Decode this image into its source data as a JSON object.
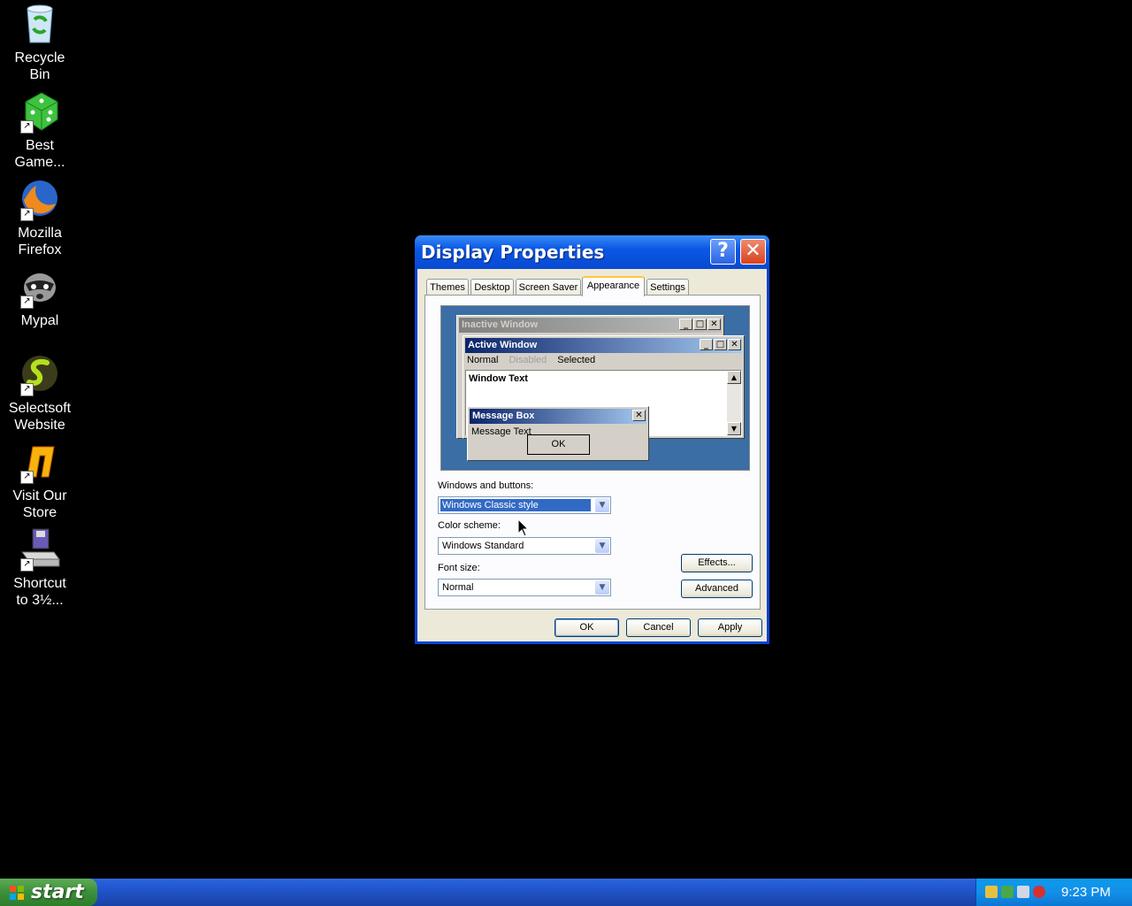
{
  "desktop": {
    "icons": [
      {
        "label": "Recycle\nBin",
        "icon": "recycle-bin-icon"
      },
      {
        "label": "Best\nGame...",
        "icon": "dice-icon"
      },
      {
        "label": "Mozilla\nFirefox",
        "icon": "firefox-icon"
      },
      {
        "label": "Mypal",
        "icon": "raccoon-icon"
      },
      {
        "label": "Selectsoft\nWebsite",
        "icon": "selectsoft-icon"
      },
      {
        "label": "Visit Our\nStore",
        "icon": "store-icon"
      },
      {
        "label": "Shortcut\nto 3½...",
        "icon": "floppy-drive-icon"
      }
    ]
  },
  "dialog": {
    "title": "Display Properties",
    "help_glyph": "?",
    "close_glyph": "✕",
    "tabs": [
      {
        "label": "Themes",
        "active": false
      },
      {
        "label": "Desktop",
        "active": false
      },
      {
        "label": "Screen Saver",
        "active": false
      },
      {
        "label": "Appearance",
        "active": true
      },
      {
        "label": "Settings",
        "active": false
      }
    ],
    "preview": {
      "inactive_title": "Inactive Window",
      "active_title": "Active Window",
      "menu_normal": "Normal",
      "menu_disabled": "Disabled",
      "menu_selected": "Selected",
      "window_text": "Window Text",
      "message_box_title": "Message Box",
      "message_text": "Message Text",
      "ok_label": "OK"
    },
    "windows_buttons": {
      "label": "Windows and buttons:",
      "value": "Windows Classic style"
    },
    "color_scheme": {
      "label": "Color scheme:",
      "value": "Windows Standard"
    },
    "font_size": {
      "label": "Font size:",
      "value": "Normal"
    },
    "effects_label": "Effects...",
    "advanced_label": "Advanced",
    "ok_label": "OK",
    "cancel_label": "Cancel",
    "apply_label": "Apply"
  },
  "taskbar": {
    "start_label": "start",
    "clock": "9:23 PM",
    "tray_icons": [
      "network-icon",
      "security-icon",
      "update-icon",
      "shield-icon"
    ]
  },
  "colors": {
    "desktop_bg": "#000000",
    "xp_blue": "#0843d8",
    "start_green": "#3c8f3b"
  }
}
